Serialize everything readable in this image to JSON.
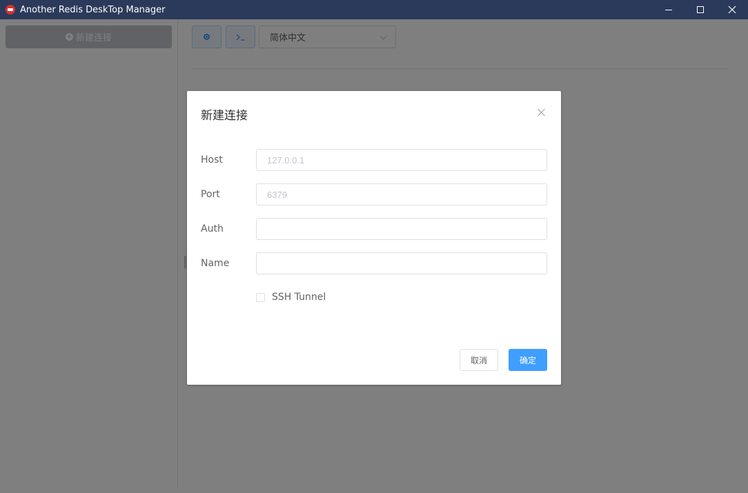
{
  "window": {
    "title": "Another Redis DeskTop Manager"
  },
  "sidebar": {
    "new_connection_label": "新建连接"
  },
  "toolbar": {
    "language_selected": "简体中文"
  },
  "dialog": {
    "title": "新建连接",
    "fields": {
      "host": {
        "label": "Host",
        "placeholder": "127.0.0.1",
        "value": ""
      },
      "port": {
        "label": "Port",
        "placeholder": "6379",
        "value": ""
      },
      "auth": {
        "label": "Auth",
        "placeholder": "",
        "value": ""
      },
      "name": {
        "label": "Name",
        "placeholder": "",
        "value": ""
      }
    },
    "ssh_tunnel_label": "SSH Tunnel",
    "ssh_tunnel_checked": false,
    "cancel_label": "取消",
    "ok_label": "确定"
  },
  "colors": {
    "titlebar": "#2b3a5b",
    "primary": "#409eff",
    "overlay": "rgba(0,0,0,0.5)"
  },
  "icons": {
    "app_logo": "redis-logo-icon",
    "minimize": "minimize-icon",
    "maximize": "maximize-icon",
    "close": "close-icon",
    "status": "dot-circle-icon",
    "console": "terminal-icon",
    "dropdown": "chevron-down-icon",
    "add": "plus-circle-icon"
  }
}
